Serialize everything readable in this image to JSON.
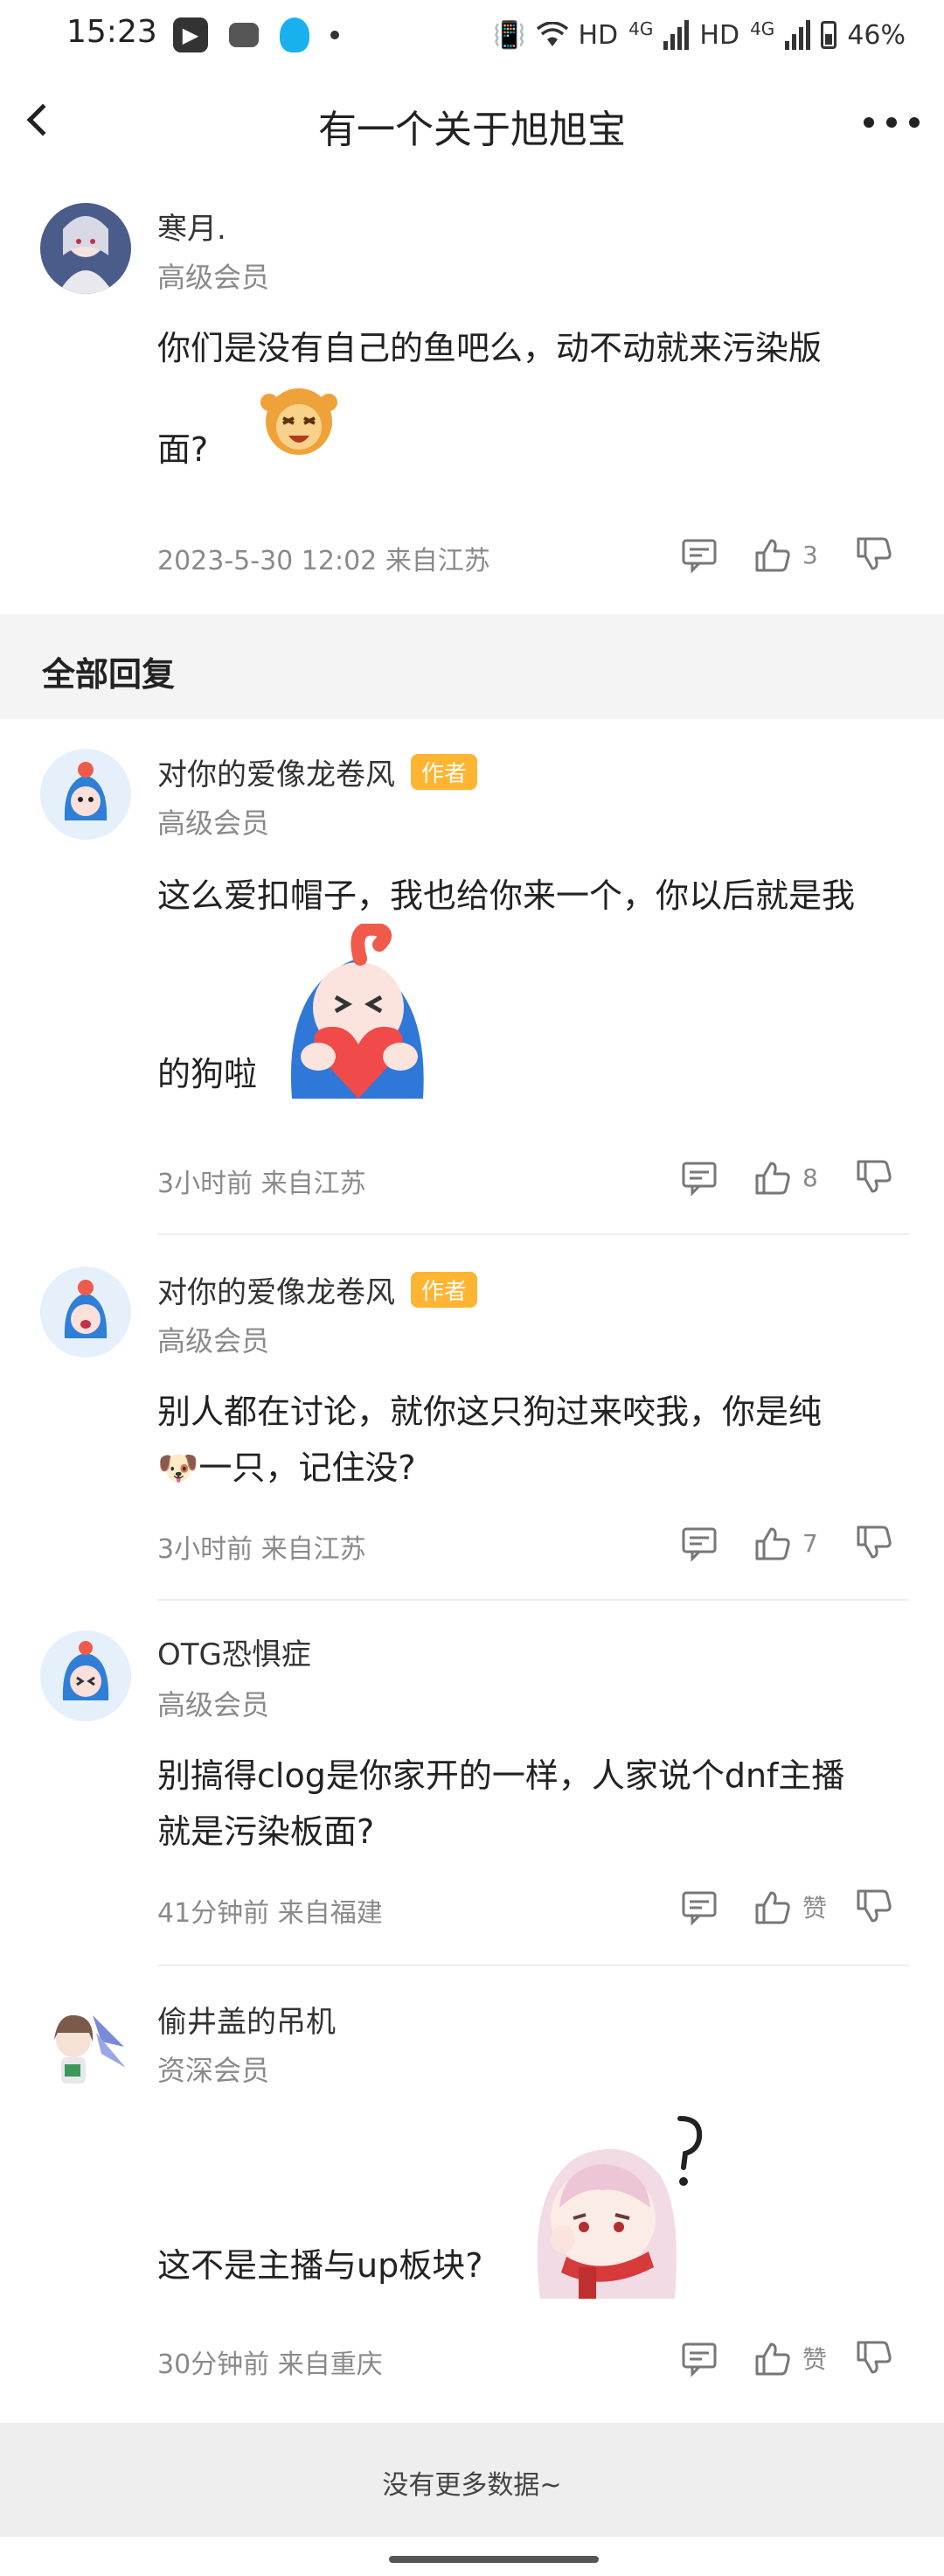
{
  "status_bar": {
    "time": "15:23",
    "network_hd1": "HD",
    "network_4g1": "4G",
    "network_hd2": "HD",
    "network_4g2": "4G",
    "battery": "46%"
  },
  "nav": {
    "title": "有一个关于旭旭宝"
  },
  "post": {
    "author": "寒月.",
    "level": "高级会员",
    "content_line1": "你们是没有自己的鱼吧么，动不动就来污染版",
    "content_line2": "面?",
    "meta": "2023-5-30 12:02  来自江苏",
    "like_count": "3"
  },
  "section": {
    "title": "全部回复"
  },
  "replies": [
    {
      "author": "对你的爱像龙卷风",
      "badge": "作者",
      "level": "高级会员",
      "content_line1": "这么爱扣帽子，我也给你来一个，你以后就是我",
      "content_line2": "的狗啦",
      "meta": "3小时前 来自江苏",
      "like_count": "8"
    },
    {
      "author": "对你的爱像龙卷风",
      "badge": "作者",
      "level": "高级会员",
      "content_line1": "别人都在讨论，就你这只狗过来咬我，你是纯",
      "content_line2": "🐶一只，记住没?",
      "meta": "3小时前 来自江苏",
      "like_count": "7"
    },
    {
      "author": "OTG恐惧症",
      "level": "高级会员",
      "content_line1": "别搞得clog是你家开的一样，人家说个dnf主播",
      "content_line2": "就是污染板面?",
      "meta": "41分钟前 来自福建",
      "like_count": "赞"
    },
    {
      "author": "偷井盖的吊机",
      "level": "资深会员",
      "content_line1": "这不是主播与up板块?",
      "meta": "30分钟前 来自重庆",
      "like_count": "赞"
    }
  ],
  "footer": {
    "text": "没有更多数据~"
  },
  "colors": {
    "badge": "#ffb531",
    "meta_gray": "#8a8a8a",
    "section_bg": "#f4f4f4"
  }
}
